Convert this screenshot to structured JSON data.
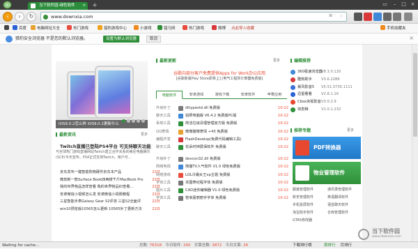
{
  "window": {
    "tab_title": "当下软件园-绿色软件",
    "tab_close": "×",
    "new_tab": "+"
  },
  "toolbar": {
    "url": "www.downxia.com",
    "go": "⊞ ·",
    "star": "☆"
  },
  "bookmarks": [
    {
      "label": "百度",
      "color": "#2a62d6"
    },
    {
      "label": "电脑网址大全",
      "color": "#e8a12f"
    },
    {
      "label": "热门游戏",
      "color": "#e94b3c"
    },
    {
      "label": "猎豹游戏中心",
      "color": "#f0a31f"
    },
    {
      "label": "小游戏",
      "color": "#f08a1f"
    },
    {
      "label": "猎马网",
      "color": "#2f8f39"
    },
    {
      "label": "热门游戏",
      "color": "#e94b3c"
    },
    {
      "label": "微博",
      "color": "#d8383a"
    },
    {
      "label": "点此导入收藏",
      "color": "#999999"
    },
    {
      "label": "手机收藏夹",
      "color": "#f08a1f"
    }
  ],
  "notice": {
    "message": "猎豹安全浏览器 不是您的默认浏览器。",
    "set_default": "设置为默认浏览器",
    "cancel": "取消",
    "close": "×"
  },
  "left": {
    "latest_title": "最新更新",
    "slide_caption": "iOS9.0.2怎么样 iOS9.0.2更新什么",
    "latest_news_title": "最新资讯",
    "more": "更多",
    "headline": "Twitch直播已登陆PS4平台 可支持聊天功能",
    "summary": "与全球热门游戏直播网站Twitch建立合作关系的索尼电脑娱乐(SCE)今天宣布，PS4正式支持Twitch，用户可…",
    "news": [
      {
        "title": "京东发布一键智能购物硬件京东本产品",
        "date": "22日"
      },
      {
        "title": "微软新一款Surface Book四两拨千斤MacBook Pro",
        "date": "22日"
      },
      {
        "title": "我的世界物品怎样查看 我的世界物品ID查看…",
        "date": "22日"
      },
      {
        "title": "安卓微信小视频怎么发 安卓微信小视频教程",
        "date": "22日"
      },
      {
        "title": "三星智能手表Galaxy Gear S2评测 三星S2全面评",
        "date": "22日"
      },
      {
        "title": "win10预览版10565怎么更新 10565补丁更新方法",
        "date": "22日"
      }
    ]
  },
  "center": {
    "promo": "谷歌向部分客户免费提供Apps for Work办公应用",
    "promo_sub": "[谷歌新版Play Store即将上]   [电气工程师计算器免费版]",
    "tabs": [
      "电脑软件",
      "安卓游戏",
      "游戏下载",
      "安卓软件",
      "苹果应用"
    ],
    "software": [
      {
        "cat": "升级补丁",
        "name": "dttypestd.dll 免费版",
        "date": "10-22",
        "color": "#7a7a7a"
      },
      {
        "cat": "聊天工具",
        "name": "拍照电脑版 V6.4.2 免费版PC版",
        "date": "10-22",
        "color": "#3f88d8"
      },
      {
        "cat": "系统工具",
        "name": "简洁垃圾清理管理官方版 免费版",
        "date": "10-22",
        "color": "#2f8f39"
      },
      {
        "cat": "QQ表情",
        "name": "微微猫微表情 +43 免费版",
        "date": "10-22",
        "color": "#e8a12f"
      },
      {
        "cat": "编程开发",
        "name": "FlashDevelop(免费代码编辑工具)",
        "date": "10-22",
        "color": "#d8383a"
      },
      {
        "cat": "聊天工具",
        "name": "花朵时钟屏保软件 免费版",
        "date": "10-22",
        "color": "#2f8f39"
      },
      {
        "cat": "升级补丁",
        "name": "devcon32.dll 免费版",
        "date": "10-22",
        "color": "#7a7a7a"
      },
      {
        "cat": "网络电视",
        "name": "熊猫TV人气软件 V1.0 绿色免费版",
        "date": "10-22",
        "color": "#3f88d8"
      },
      {
        "cat": "网络游戏",
        "name": "LOL冷霜女王xp主题 免费版",
        "date": "10-22",
        "color": "#e94b3c"
      },
      {
        "cat": "字体工具",
        "name": "本图寿纪程字体 免费版",
        "date": "10-22",
        "color": "#777777"
      },
      {
        "cat": "图片工具",
        "name": "CAD迷你编辑器 V1.0 绿色免费版",
        "date": "10-22",
        "color": "#2f8f39"
      },
      {
        "cat": "字体工具",
        "name": "管家嘉丽丽手字体 免费版",
        "date": "10-22",
        "color": "#777777"
      }
    ]
  },
  "right": {
    "editor_title": "编辑推荐",
    "items": [
      {
        "name": "360极速浏览器",
        "version": "V8.3.0.120",
        "color": "#3f88d8"
      },
      {
        "name": "酷狗助手",
        "version": "V3.6.2286",
        "color": "#d8383a"
      },
      {
        "name": "暴风影音5",
        "version": "V5.51.0730.1111",
        "color": "#3a6fd8"
      },
      {
        "name": "迅雷看看",
        "version": "V2.8.1.16",
        "color": "#2a62d6"
      },
      {
        "name": "Cbox央视影音",
        "version": "V3.0.2.9",
        "color": "#e8482f"
      },
      {
        "name": "快剪辑",
        "version": "V1.0.1.232",
        "color": "#2f8f39"
      }
    ],
    "topic_title": "推荐专题",
    "banner1": "PDF转换器",
    "banner2": "物业管理软件",
    "links": [
      "服装管理软件",
      "通讯录管理软件",
      "账务管理软件",
      "英语翻译软件",
      "手机投屏软件",
      "语音聊天软件",
      "淘宝助手软件",
      "仓库管理软件",
      "GTA5修改器"
    ],
    "more": "更多"
  },
  "status": {
    "text": "Waiting for cache...",
    "total_label": "总数:",
    "total": "76318",
    "today_label": "今日软件:",
    "today": "240",
    "articles_label": "文章总数:",
    "articles": "3872",
    "today_articles_label": "今日文章:",
    "today_articles": "26",
    "rank": "下载排行榜",
    "rank_week": "周排行",
    "rank_month": "月排行"
  },
  "watermark": {
    "title": "当下软件园",
    "sub": "www.downxia.com"
  }
}
